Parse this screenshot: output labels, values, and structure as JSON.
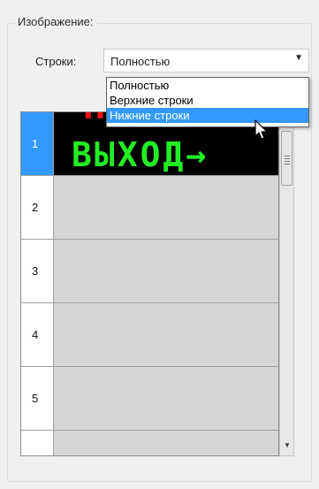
{
  "group": {
    "title": "Изображение:"
  },
  "rows_field": {
    "label": "Строки:",
    "value": "Полностью",
    "options": [
      "Полностью",
      "Верхние строки",
      "Нижние строки"
    ],
    "highlighted_option": "Нижние строки"
  },
  "grid": {
    "rows": [
      {
        "num": "1",
        "selected": true,
        "preview": {
          "top_text": "ПОЖАР",
          "bottom_text": "ВЫХОД→",
          "top_color": "#ff1010",
          "bottom_color": "#22ee22",
          "background": "#000000"
        }
      },
      {
        "num": "2",
        "selected": false
      },
      {
        "num": "3",
        "selected": false
      },
      {
        "num": "4",
        "selected": false
      },
      {
        "num": "5",
        "selected": false
      },
      {
        "num": "",
        "selected": false
      }
    ]
  },
  "colors": {
    "selection": "#3399ff",
    "empty_cell": "#d6d6d6"
  },
  "icons": {
    "combo_arrow": "chevron-down-icon",
    "cursor": "mouse-pointer-icon"
  }
}
